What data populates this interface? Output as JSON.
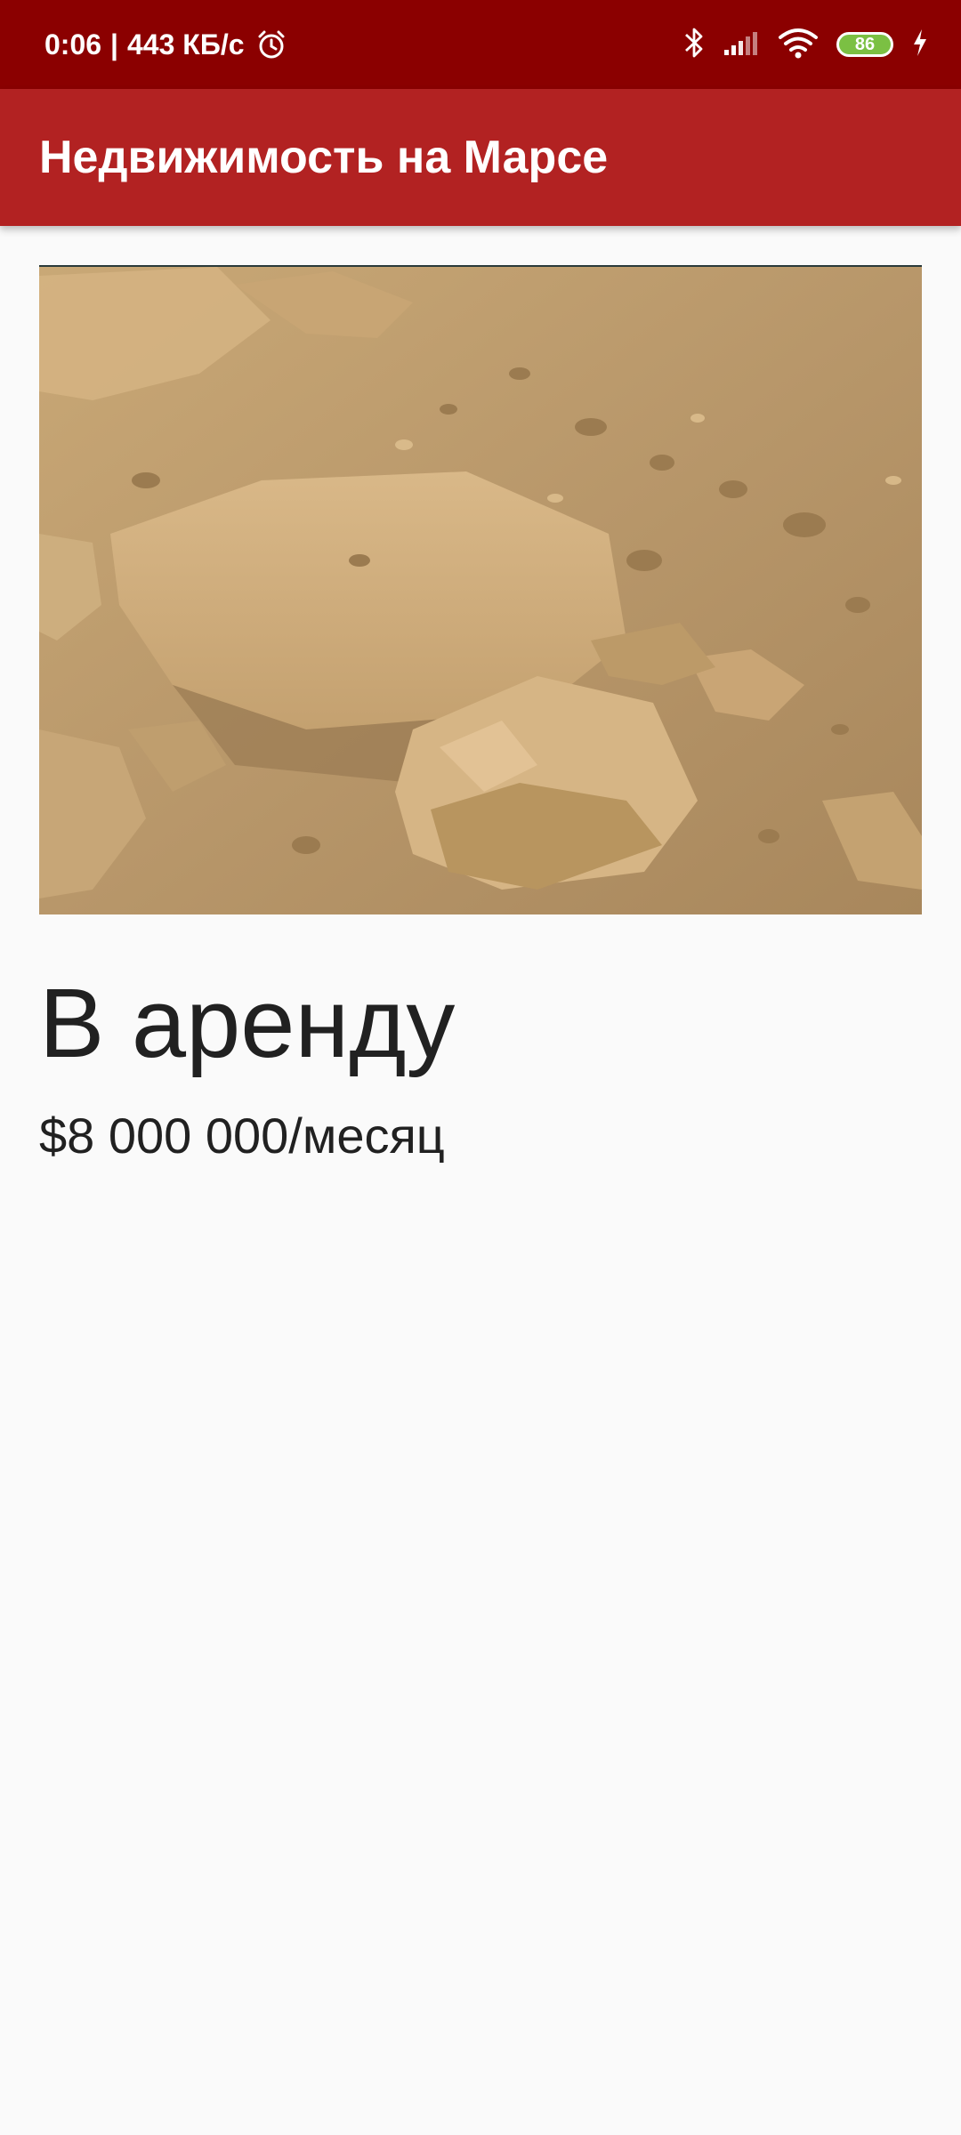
{
  "status_bar": {
    "time": "0:06",
    "separator": "|",
    "network_speed": "443 КБ/с",
    "battery_level": "86",
    "icons": [
      "alarm-icon",
      "bluetooth-icon",
      "signal-icon",
      "wifi-icon",
      "battery-icon",
      "charging-icon"
    ],
    "background_color": "#8b0000"
  },
  "app_bar": {
    "title": "Недвижимость на Марсе",
    "background_color": "#b22222"
  },
  "listing": {
    "type": "В аренду",
    "price": "$8 000 000/месяц"
  }
}
